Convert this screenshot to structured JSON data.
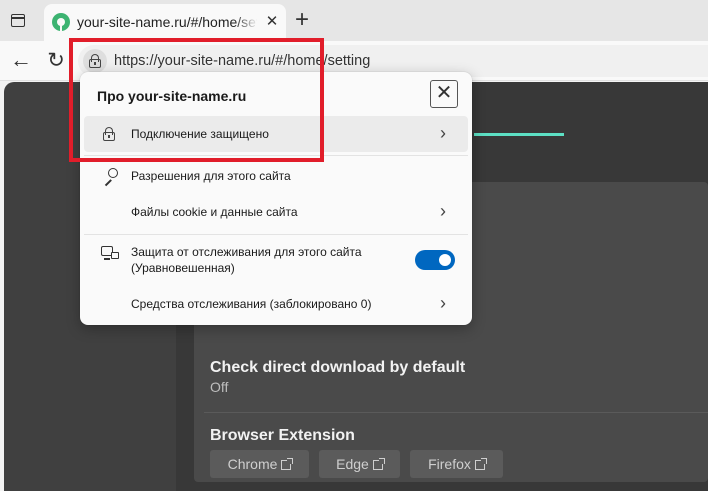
{
  "browser": {
    "tab": {
      "title": "your-site-name.ru/#/home/settings"
    },
    "address_bar": {
      "url": "https://your-site-name.ru/#/home/setting"
    }
  },
  "popup": {
    "title": "Про your-site-name.ru",
    "close_glyph": "✕",
    "items": [
      {
        "label": "Подключение защищено",
        "icon": "lock-icon",
        "has_chevron": true
      },
      {
        "label": "Разрешения для этого сайта",
        "icon": "key-icon",
        "has_chevron": false
      },
      {
        "label": "Файлы cookie и данные сайта",
        "icon": "",
        "has_chevron": true
      },
      {
        "label_line1": "Защита от отслеживания для этого сайта",
        "label_line2": "(Уравновешенная)",
        "icon": "tracking-icon",
        "toggle_on": true
      },
      {
        "label": "Средства отслеживания (заблокировано 0)",
        "icon": "",
        "has_chevron": true
      }
    ]
  },
  "page": {
    "setting": {
      "title": "Check direct download by default",
      "value": "Off"
    },
    "extension": {
      "title": "Browser Extension",
      "buttons": [
        "Chrome",
        "Edge",
        "Firefox"
      ]
    }
  },
  "colors": {
    "accent": "#5de0c4",
    "highlight_box": "#e11d2a",
    "toggle": "#0067c0"
  }
}
